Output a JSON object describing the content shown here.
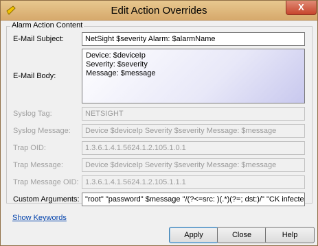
{
  "window": {
    "title": "Edit Action Overrides",
    "close_label": "X"
  },
  "group": {
    "legend": "Alarm Action Content"
  },
  "fields": {
    "email_subject": {
      "label": "E-Mail Subject:",
      "value": "NetSight $severity Alarm: $alarmName"
    },
    "email_body": {
      "label": "E-Mail Body:",
      "lines": [
        "Device: $deviceIp",
        "Severity: $severity",
        "Message: $message"
      ]
    },
    "syslog_tag": {
      "label": "Syslog Tag:",
      "value": "NETSIGHT"
    },
    "syslog_message": {
      "label": "Syslog Message:",
      "value": "Device $deviceIp Severity $severity Message: $message"
    },
    "trap_oid": {
      "label": "Trap OID:",
      "value": "1.3.6.1.4.1.5624.1.2.105.1.0.1"
    },
    "trap_message": {
      "label": "Trap Message:",
      "value": "Device $deviceIp Severity $severity Message: $message"
    },
    "trap_message_oid": {
      "label": "Trap Message OID:",
      "value": "1.3.6.1.4.1.5624.1.2.105.1.1.1"
    },
    "custom_arguments": {
      "label": "Custom Arguments:",
      "value": "\"root\" \"password\" $message \"/(?<=src: )(.*)(?=; dst:)/\" \"CK infecte"
    }
  },
  "links": {
    "show_keywords": "Show Keywords"
  },
  "buttons": {
    "apply": "Apply",
    "close": "Close",
    "help": "Help"
  }
}
